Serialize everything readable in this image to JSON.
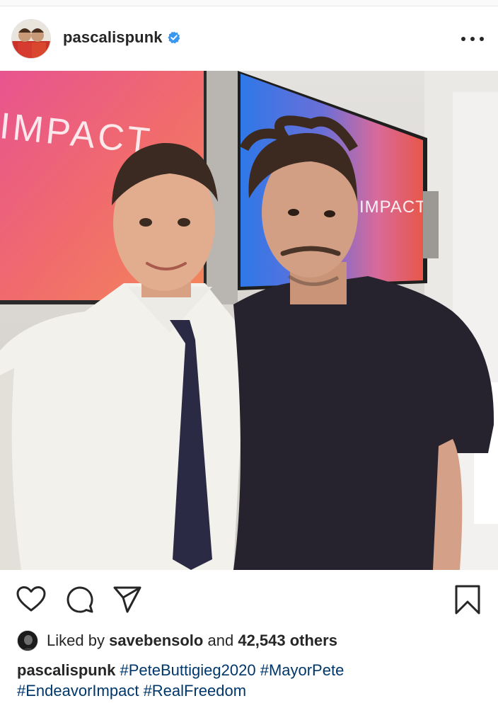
{
  "post": {
    "username": "pascalispunk",
    "verified_icon": "verified-badge-icon",
    "more_icon": "more-options-icon"
  },
  "photo": {
    "screen_text_left": "IMPACT",
    "screen_text_right": "IMPACT"
  },
  "actions": {
    "like_icon": "heart-icon",
    "comment_icon": "comment-icon",
    "share_icon": "send-icon",
    "save_icon": "bookmark-icon"
  },
  "likes": {
    "prefix": "Liked by",
    "user": "savebensolo",
    "middle": "and",
    "count_text": "42,543 others"
  },
  "caption": {
    "username": "pascalispunk",
    "hashtags": [
      "#PeteButtigieg2020",
      "#MayorPete",
      "#EndeavorImpact",
      "#RealFreedom"
    ]
  },
  "colors": {
    "text": "#262626",
    "hashtag": "#00376b",
    "verified": "#3897f0"
  }
}
